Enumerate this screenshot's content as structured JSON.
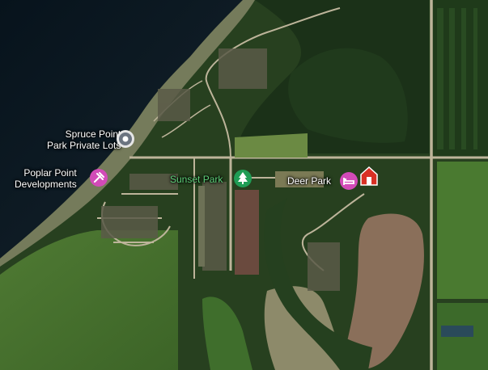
{
  "map": {
    "type": "satellite",
    "places": [
      {
        "id": "spruce-point",
        "label_line1": "Spruce Point",
        "label_line2": "Park Private Lots",
        "icon": "pin-icon",
        "color": "#e6e6e6"
      },
      {
        "id": "poplar-point",
        "label_line1": "Poplar Point",
        "label_line2": "Developments",
        "icon": "hammer-wrench-icon",
        "color": "#d24bb8"
      },
      {
        "id": "sunset-park",
        "label": "Sunset Park",
        "icon": "tree-icon",
        "color": "#1f9d55"
      },
      {
        "id": "deer-park",
        "label": "Deer Park",
        "icon": "bed-icon",
        "color": "#d24bb8"
      },
      {
        "id": "red-marker",
        "icon": "house-icon",
        "color": "#d93025"
      }
    ]
  }
}
